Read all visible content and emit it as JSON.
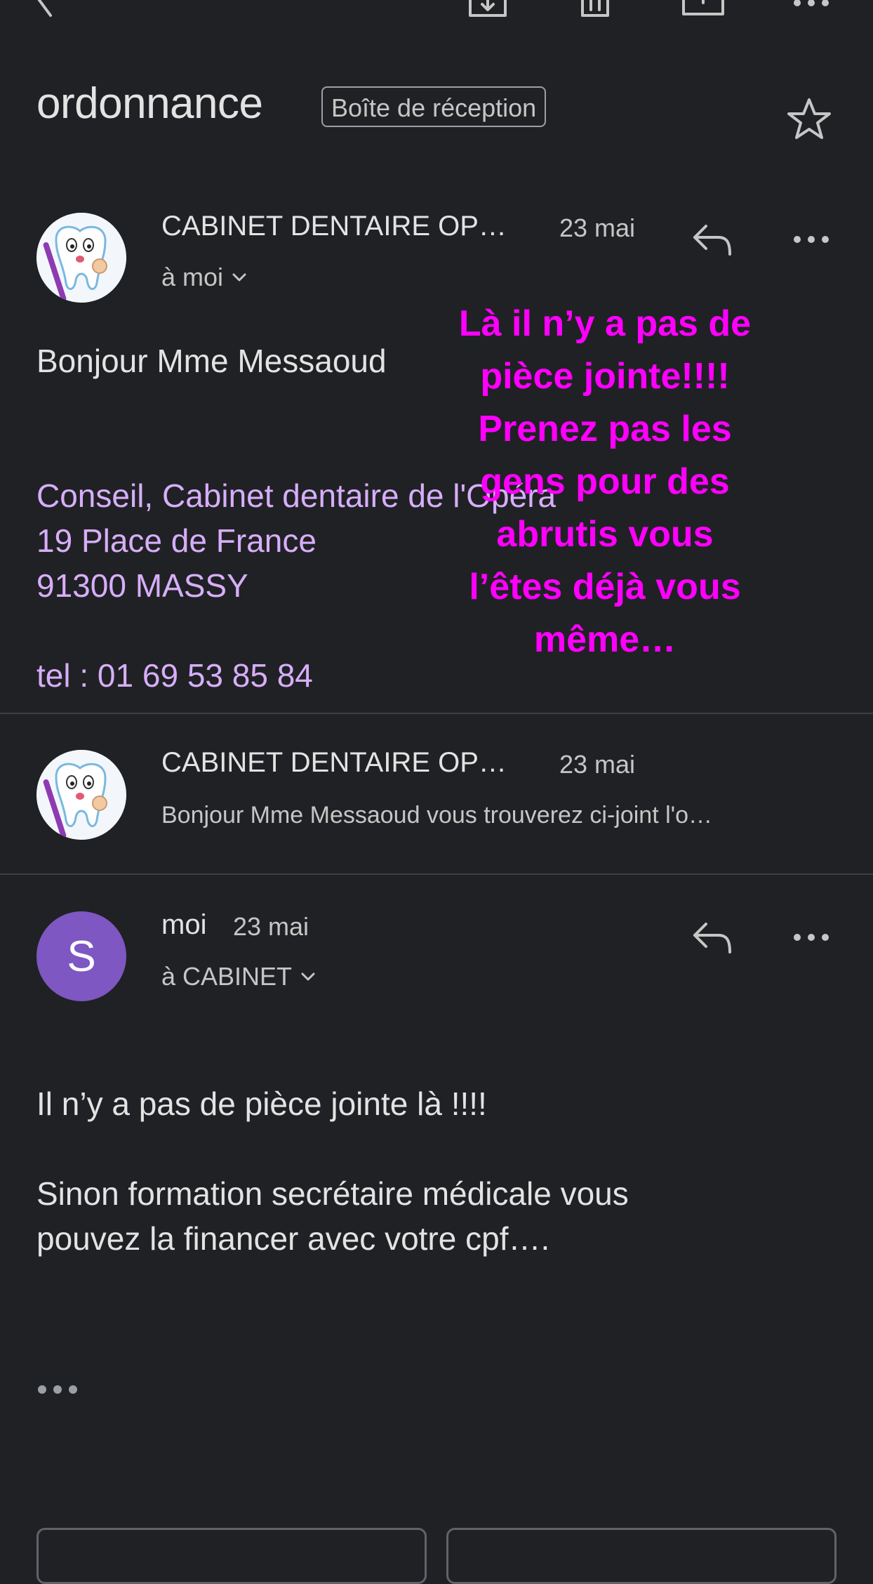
{
  "subject": "ordonnance",
  "label": "Boîte de réception",
  "messages": [
    {
      "sender": "CABINET DENTAIRE OP…",
      "date": "23 mai",
      "to": "à moi",
      "body": {
        "greeting": "Bonjour Mme Messaoud",
        "signature": [
          "Conseil, Cabinet dentaire de l'Opéra",
          "19 Place de France",
          "91300 MASSY",
          "tel : 01 69 53 85 84"
        ]
      }
    },
    {
      "sender": "CABINET DENTAIRE OP…",
      "date": "23 mai",
      "snippet": "Bonjour Mme Messaoud vous trouverez ci-joint l'o…"
    },
    {
      "sender": "moi",
      "avatar_letter": "S",
      "date": "23 mai",
      "to": "à CABINET",
      "body": {
        "line1": "Il n’y a pas de pièce jointe là !!!!",
        "line2": "Sinon formation secrétaire médicale vous",
        "line3": "pouvez la financer avec votre cpf…."
      }
    }
  ],
  "overlay_annotation": [
    "Là il n’y a pas de",
    "pièce jointe!!!!",
    "Prenez pas les",
    "gens pour des",
    "abrutis vous",
    "l’êtes déjà vous",
    "même…"
  ],
  "colors": {
    "background": "#202124",
    "signature": "#d7aefb",
    "overlay": "#ff00ff",
    "avatar_s": "#7e57c2"
  },
  "icons": [
    "back-arrow-icon",
    "archive-icon",
    "delete-icon",
    "mark-unread-icon",
    "more-options-icon",
    "star-icon",
    "reply-icon",
    "chevron-down-icon",
    "show-trimmed-content-icon"
  ]
}
